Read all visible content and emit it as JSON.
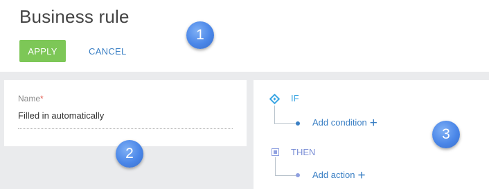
{
  "header": {
    "title": "Business rule",
    "apply_label": "APPLY",
    "cancel_label": "CANCEL"
  },
  "left_panel": {
    "field_label": "Name",
    "required_marker": "*",
    "field_value": "Filled in automatically"
  },
  "rule_panel": {
    "if_label": "IF",
    "add_condition_label": "Add condition",
    "then_label": "THEN",
    "add_action_label": "Add action",
    "plus_glyph": "+"
  },
  "callouts": [
    "1",
    "2",
    "3"
  ],
  "colors": {
    "apply_bg": "#7dc757",
    "link": "#3a7fc4",
    "if_accent": "#3ba6e3",
    "then_accent": "#7b8fd6",
    "badge": "#4a86e8",
    "workspace_bg": "#eaebed"
  },
  "icons": {
    "if": "diamond-icon",
    "then": "square-icon",
    "add": "plus-icon"
  }
}
